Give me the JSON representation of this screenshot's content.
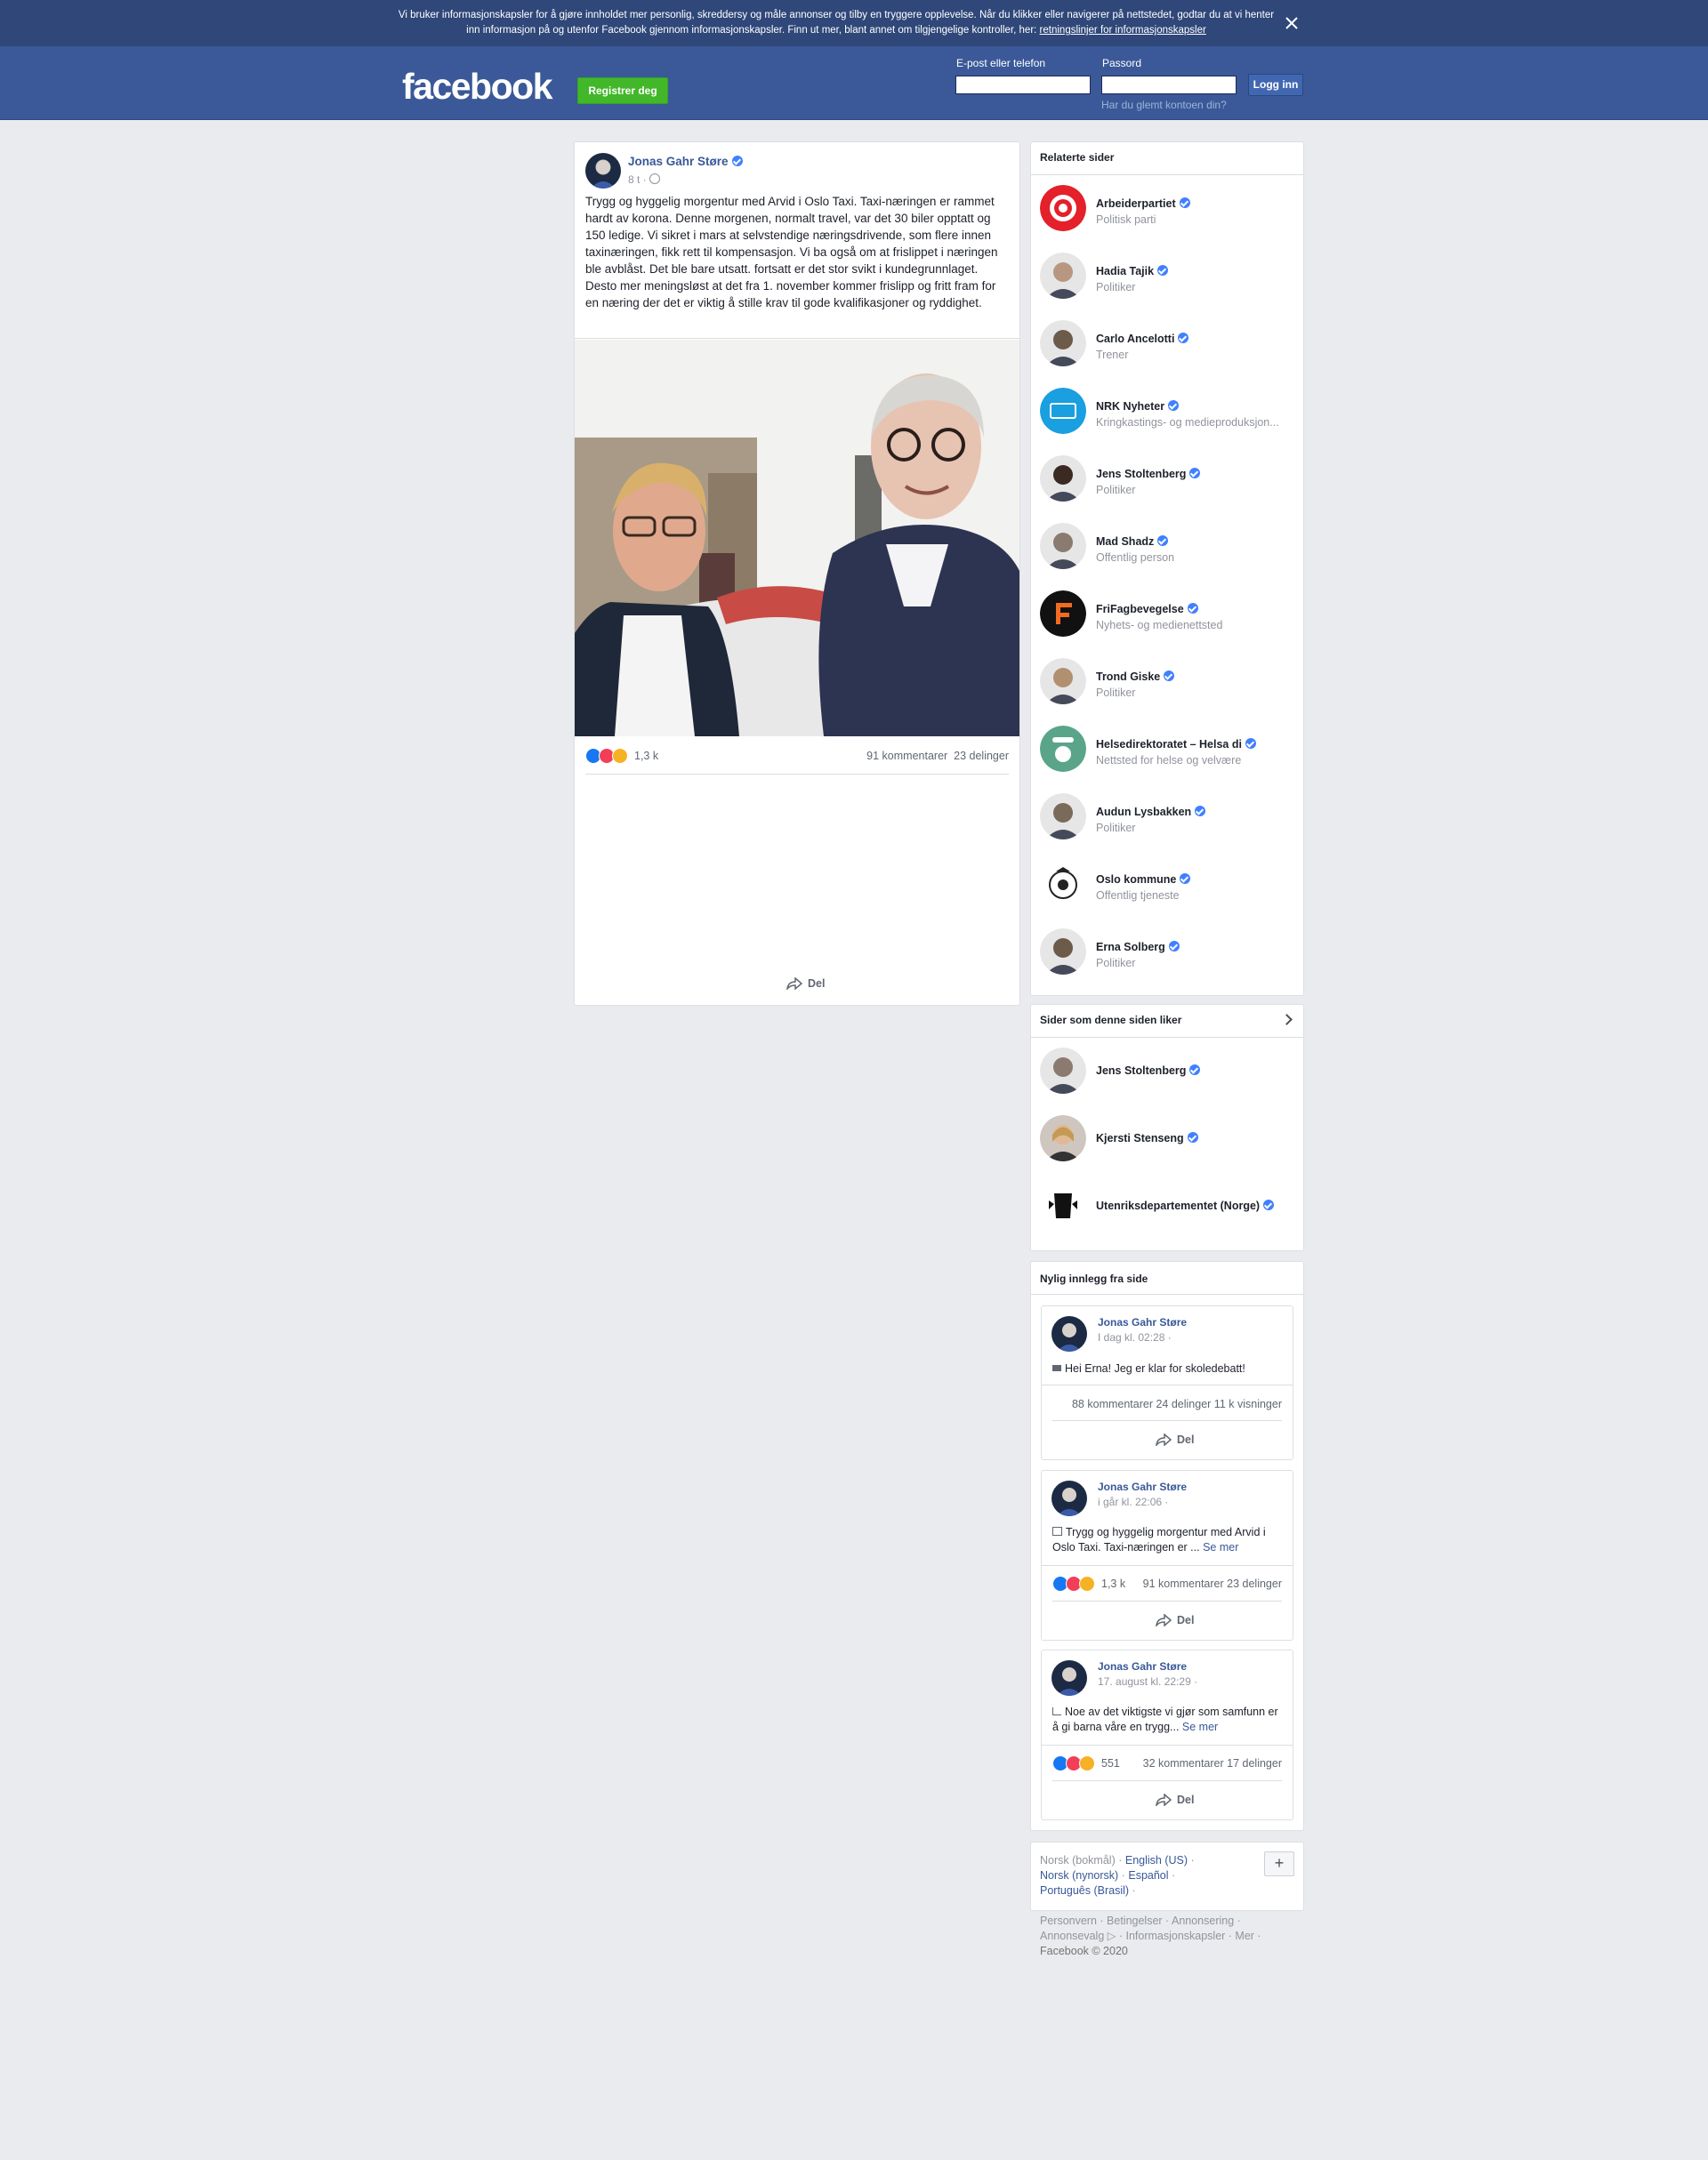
{
  "cookie_banner": {
    "text": "Vi bruker informasjonskapsler for å gjøre innholdet mer personlig, skreddersy og måle annonser og tilby en tryggere opplevelse. Når du klikker eller navigerer på nettstedet, godtar du at vi henter inn informasjon på og utenfor Facebook gjennom informasjonskapsler. Finn ut mer, blant annet om tilgjengelige kontroller, her: ",
    "link": "retningslinjer for informasjonskapsler",
    "close_icon": "close-icon"
  },
  "header": {
    "logo": "facebook",
    "register": "Registrer deg",
    "email_label": "E-post eller telefon",
    "password_label": "Passord",
    "login": "Logg inn",
    "forgot": "Har du glemt kontoen din?",
    "email_value": "",
    "password_value": ""
  },
  "post": {
    "author": "Jonas Gahr Støre",
    "time": "8 t ·",
    "text": "Trygg og hyggelig morgentur med Arvid i Oslo Taxi. Taxi-næringen er rammet hardt av korona. Denne morgenen, normalt travel, var det 30 biler opptatt og 150 ledige. Vi sikret i mars at selvstendige næringsdrivende, som flere innen taxinæringen, fikk rett til kompensasjon. Vi ba også om at frislippet i næringen ble avblåst. Det ble bare utsatt. fortsatt er det stor svikt i kundegrunnlaget. Desto mer meningsløst at det fra 1. november kommer frislipp og fritt fram for en næring der det er viktig å stille krav til gode kvalifikasjoner og ryddighet.",
    "reactions": "1,3 k",
    "comments": "91 kommentarer",
    "shares": "23 delinger",
    "share_label": "Del"
  },
  "related": {
    "title": "Relaterte sider",
    "items": [
      {
        "name": "Arbeiderpartiet",
        "category": "Politisk parti",
        "icon": "red-rose-logo"
      },
      {
        "name": "Hadia Tajik",
        "category": "Politiker",
        "icon": "profile-photo"
      },
      {
        "name": "Carlo Ancelotti",
        "category": "Trener",
        "icon": "profile-photo"
      },
      {
        "name": "NRK Nyheter",
        "category": "Kringkastings- og medieproduksjon...",
        "icon": "nrk-logo"
      },
      {
        "name": "Jens Stoltenberg",
        "category": "Politiker",
        "icon": "profile-photo"
      },
      {
        "name": "Mad Shadz",
        "category": "Offentlig person",
        "icon": "profile-photo"
      },
      {
        "name": "FriFagbevegelse",
        "category": "Nyhets- og medienettsted",
        "icon": "f-logo"
      },
      {
        "name": "Trond Giske",
        "category": "Politiker",
        "icon": "profile-photo"
      },
      {
        "name": "Helsedirektoratet – Helsa di",
        "category": "Nettsted for helse og velvære",
        "icon": "helsa-di-logo"
      },
      {
        "name": "Audun Lysbakken",
        "category": "Politiker",
        "icon": "profile-photo"
      },
      {
        "name": "Oslo kommune",
        "category": "Offentlig tjeneste",
        "icon": "oslo-seal"
      },
      {
        "name": "Erna Solberg",
        "category": "Politiker",
        "icon": "profile-photo"
      }
    ]
  },
  "liked": {
    "title": "Sider som denne siden liker",
    "items": [
      {
        "name": "Jens Stoltenberg"
      },
      {
        "name": "Kjersti Stenseng"
      },
      {
        "name": "Utenriksdepartementet (Norge)"
      }
    ]
  },
  "recent": {
    "title": "Nylig innlegg fra side",
    "posts": [
      {
        "author": "Jonas Gahr Støre",
        "time": "I dag kl. 02:28 ·",
        "text": "Hei Erna! Jeg er klar for skoledebatt!",
        "see_more": "",
        "reactions": "",
        "stats": "88 kommentarer   24 delinger   11 k visninger",
        "share": "Del"
      },
      {
        "author": "Jonas Gahr Støre",
        "time": "i går kl. 22:06 ·",
        "text": "Trygg og hyggelig morgentur med Arvid i Oslo Taxi. Taxi-næringen er ... ",
        "see_more": "Se mer",
        "reactions": "1,3 k",
        "stats": "91 kommentarer   23 delinger",
        "share": "Del"
      },
      {
        "author": "Jonas Gahr Støre",
        "time": "17. august kl. 22:29 ·",
        "text": "Noe av det viktigste vi gjør som samfunn er å gi barna våre en trygg... ",
        "see_more": "Se mer",
        "reactions": "551",
        "stats": "32 kommentarer   17 delinger",
        "share": "Del"
      }
    ]
  },
  "languages": {
    "current": "Norsk (bokmål) ·",
    "en": "English (US)",
    "nn": "Norsk (nynorsk)",
    "es": "Español",
    "pt": "Português (Brasil)",
    "plus": "+"
  },
  "footer": {
    "links": "Personvern · Betingelser · Annonsering · Annonsevalg ▷ · Informasjonskapsler · Mer ·",
    "copyright": "Facebook © 2020"
  },
  "colors": {
    "brand": "#3b5998",
    "accent_green": "#42b72a",
    "verified": "#4080ff"
  }
}
